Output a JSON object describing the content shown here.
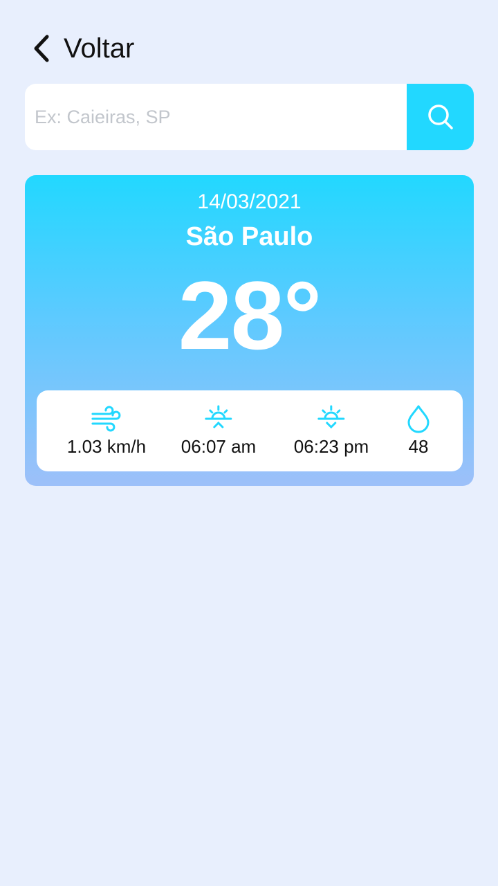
{
  "header": {
    "back_label": "Voltar",
    "back_icon": "chevron-left-icon"
  },
  "search": {
    "placeholder": "Ex: Caieiras, SP",
    "value": "",
    "icon": "search-icon"
  },
  "weather": {
    "date": "14/03/2021",
    "city": "São Paulo",
    "temperature": "28°",
    "details": [
      {
        "icon": "wind-icon",
        "value": "1.03 km/h"
      },
      {
        "icon": "sunrise-icon",
        "value": "06:07 am"
      },
      {
        "icon": "sunset-icon",
        "value": "06:23 pm"
      },
      {
        "icon": "humidity-drop-icon",
        "value": "48"
      }
    ]
  },
  "colors": {
    "accent": "#22d8ff",
    "background": "#e8effd",
    "card_gradient_top": "#22d8ff",
    "card_gradient_bottom": "#9dc0f9"
  }
}
